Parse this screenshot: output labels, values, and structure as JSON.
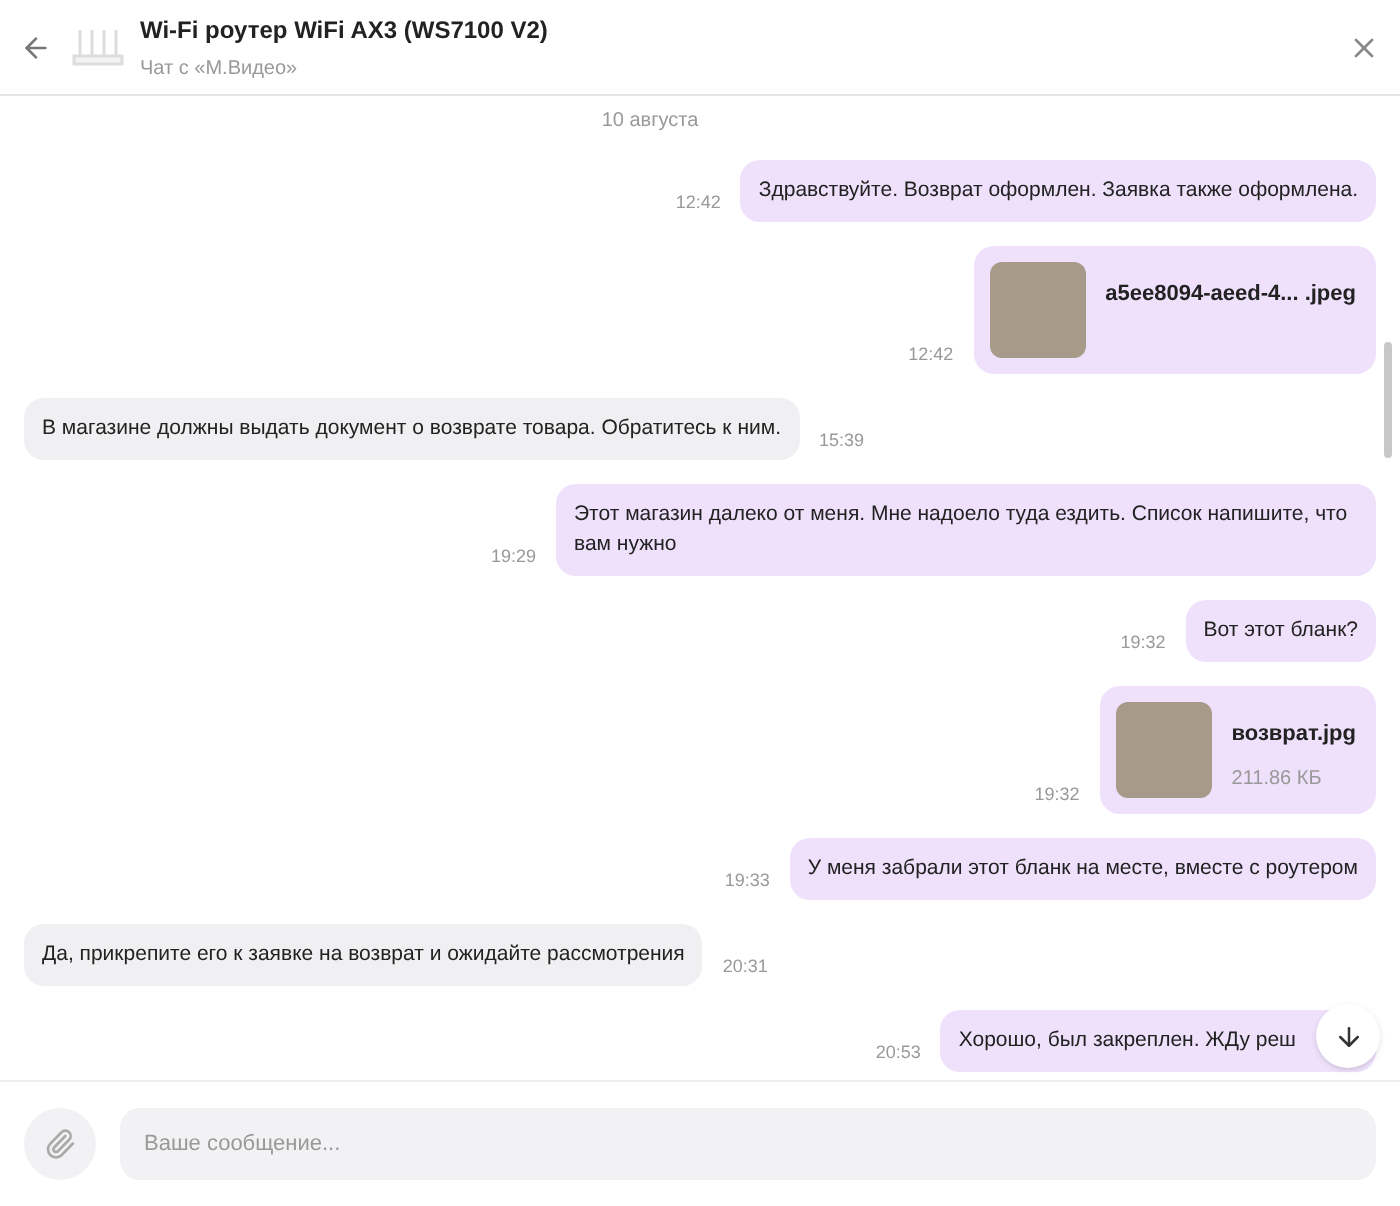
{
  "header": {
    "title": "Wi-Fi роутер WiFi AX3 (WS7100 V2)",
    "subtitle": "Чат с «М.Видео»"
  },
  "date": "10 августа",
  "messages": [
    {
      "kind": "text",
      "outgoing": true,
      "text": "Здравствуйте. Возврат оформлен. Заявка также оформлена.",
      "time": "12:42"
    },
    {
      "kind": "file",
      "outgoing": true,
      "name": "a5ee8094-aeed-4... .jpeg",
      "time": "12:42"
    },
    {
      "kind": "text",
      "outgoing": false,
      "text": "В магазине должны выдать документ о возврате товара. Обратитесь к ним.",
      "time": "15:39"
    },
    {
      "kind": "text",
      "outgoing": true,
      "text": "Этот магазин далеко от меня. Мне надоело туда ездить. Список напишите, что вам нужно",
      "time": "19:29"
    },
    {
      "kind": "text",
      "outgoing": true,
      "text": "Вот этот бланк?",
      "time": "19:32"
    },
    {
      "kind": "file",
      "outgoing": true,
      "name": "возврат.jpg",
      "size": "211.86 КБ",
      "time": "19:32"
    },
    {
      "kind": "text",
      "outgoing": true,
      "text": "У меня забрали этот бланк на месте, вместе с роутером",
      "time": "19:33"
    },
    {
      "kind": "text",
      "outgoing": false,
      "text": "Да, прикрепите его к заявке на возврат и ожидайте рассмотрения",
      "time": "20:31"
    },
    {
      "kind": "text",
      "outgoing": true,
      "text": "Хорошо, был закреплен. ЖДу реш",
      "time": "20:53"
    }
  ],
  "composer": {
    "placeholder": "Ваше сообщение..."
  }
}
